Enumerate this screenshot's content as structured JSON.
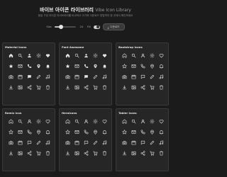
{
  "header": {
    "title": "바이브 아이콘 라이브러리",
    "title_en": "Vibe Icon Library",
    "subtitle": "동일 구성 아이콘 라이브러리를 비교하고 크기와 다운로드 방법까지 한 곳에서 확인하세요",
    "controls": {
      "size_label": "Size",
      "size_value": 24,
      "size_value_text": "24",
      "slider_fraction": 0.3,
      "stroke_label": "Fill",
      "stroke_toggle_on": true,
      "download_label": "다운로드"
    }
  },
  "colors": {
    "background": "#1b1b1b",
    "card": "#262626",
    "icon": "#e4e4e4"
  },
  "libraries": [
    {
      "name": "Material Icons"
    },
    {
      "name": "Font Awesome"
    },
    {
      "name": "Bootstrap Icons"
    },
    {
      "name": "Remix Icon"
    },
    {
      "name": "Heroicons"
    },
    {
      "name": "Tabler Icons"
    }
  ],
  "icon_set": [
    "home-icon",
    "search-icon",
    "user-icon",
    "settings-icon",
    "heart-icon",
    "star-icon",
    "mail-icon",
    "phone-icon",
    "location-icon",
    "bell-icon",
    "camera-icon",
    "calendar-icon",
    "chat-icon",
    "edit-icon",
    "music-icon",
    "download-icon",
    "image-icon",
    "share-icon",
    "cart-icon",
    "trash-icon"
  ]
}
